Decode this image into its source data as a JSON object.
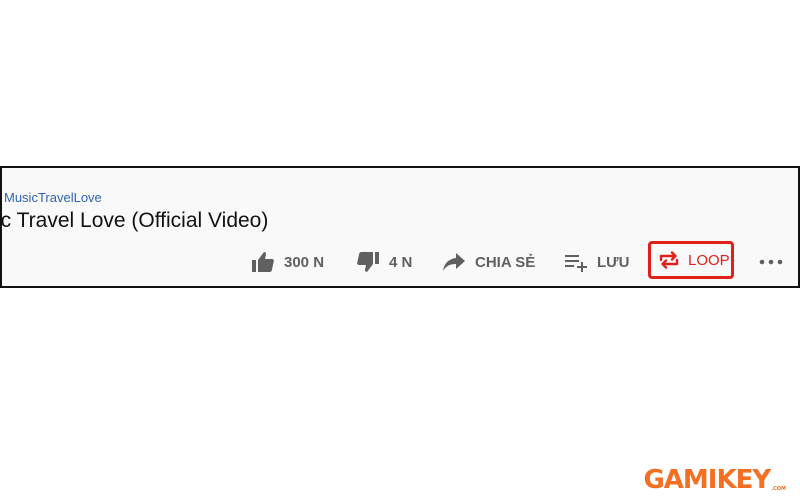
{
  "video": {
    "channel": "MusicTravelLove",
    "title": "ic Travel Love (Official Video)"
  },
  "actions": {
    "like_count": "300 N",
    "dislike_count": "4 N",
    "share_label": "CHIA SẺ",
    "save_label": "LƯU",
    "loop_label": "LOOP"
  },
  "icons": {
    "like": "thumbs-up-icon",
    "dislike": "thumbs-down-icon",
    "share": "share-arrow-icon",
    "save": "playlist-add-icon",
    "loop": "loop-icon",
    "more": "more-horizontal-icon"
  },
  "colors": {
    "channel_link": "#2f63b5",
    "action_text": "#606060",
    "loop_highlight": "#e0201b",
    "watermark": "#f36f21"
  },
  "watermark": {
    "text": "GAMIKEY",
    "subtext": ".COM"
  }
}
